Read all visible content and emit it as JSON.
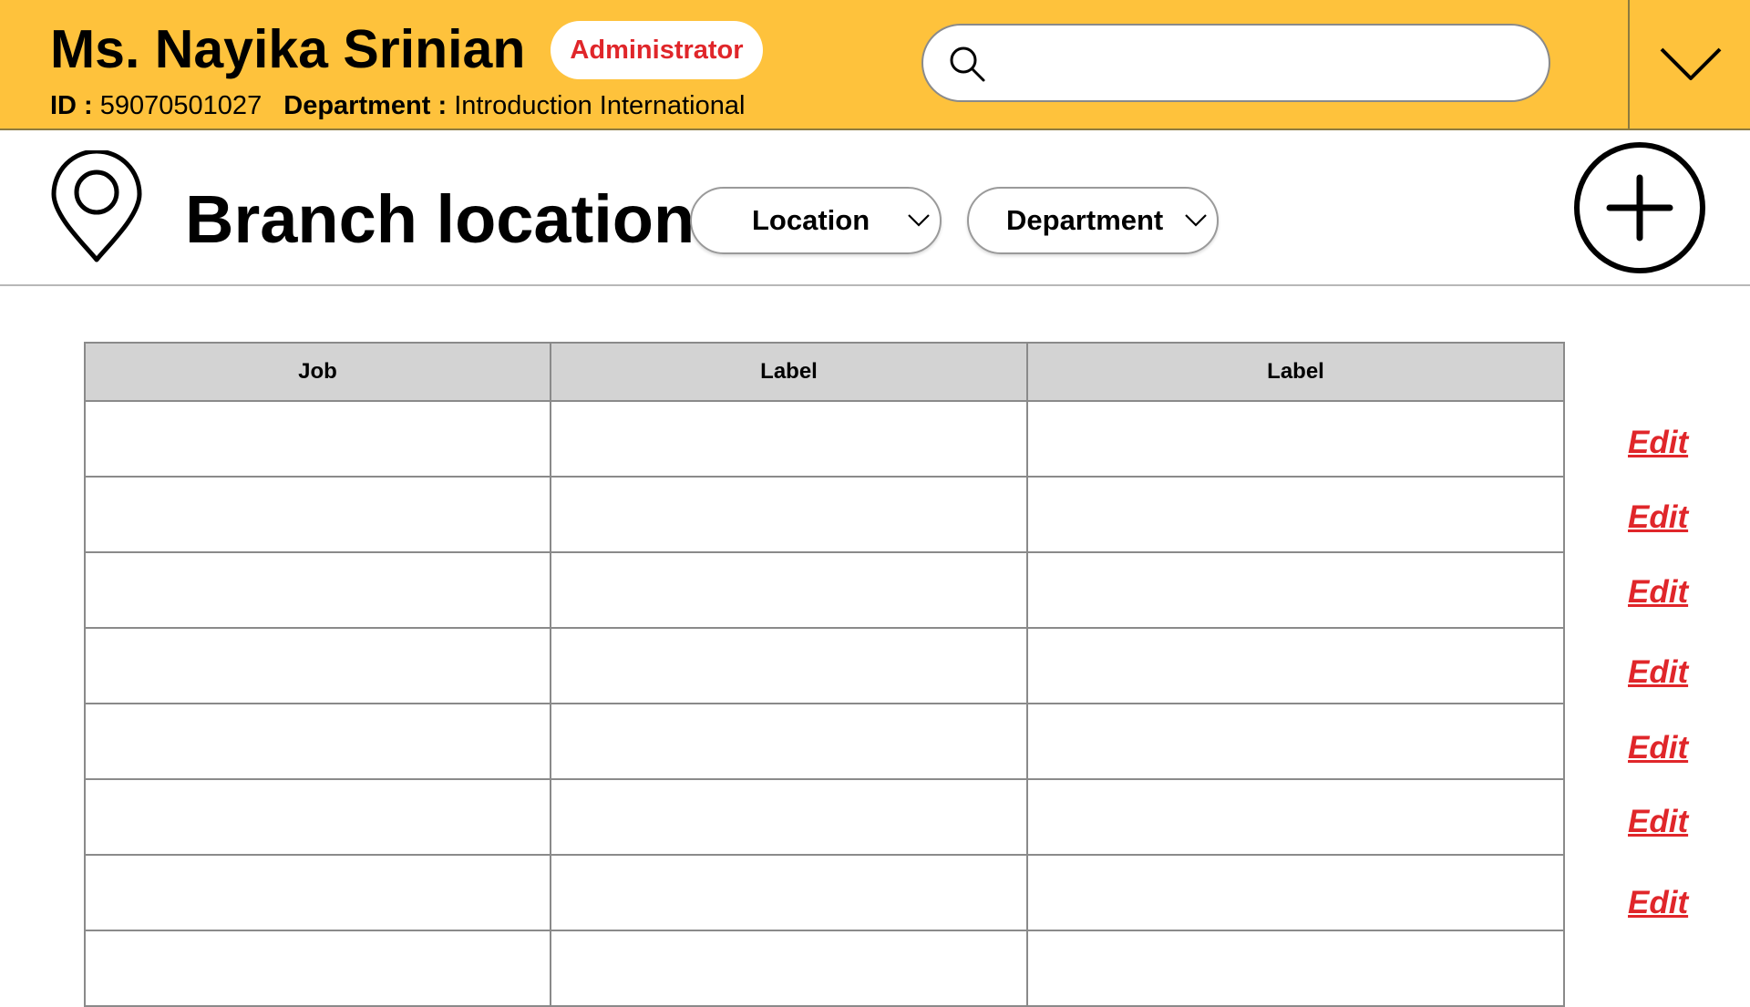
{
  "header": {
    "user_name": "Ms. Nayika Srinian",
    "role_badge": "Administrator",
    "id_label": "ID :",
    "id_value": "59070501027",
    "department_label": "Department :",
    "department_value": "Introduction International",
    "search": {
      "placeholder": "",
      "value": "",
      "icon": "search-icon"
    },
    "menu_icon": "chevron-down-icon",
    "background_color": "#FEC23C"
  },
  "page": {
    "title": "Branch location",
    "title_icon": "map-pin-icon",
    "filters": [
      {
        "label": "Location"
      },
      {
        "label": "Department"
      }
    ],
    "add_icon": "add-circle-icon"
  },
  "table": {
    "columns": [
      "Job",
      "Label",
      "Label"
    ],
    "rows": [
      [
        "",
        "",
        ""
      ],
      [
        "",
        "",
        ""
      ],
      [
        "",
        "",
        ""
      ],
      [
        "",
        "",
        ""
      ],
      [
        "",
        "",
        ""
      ],
      [
        "",
        "",
        ""
      ],
      [
        "",
        "",
        ""
      ],
      [
        "",
        "",
        ""
      ]
    ],
    "edit_label": "Edit",
    "edit_color": "#E0262A",
    "header_color": "#D3D3D3"
  }
}
